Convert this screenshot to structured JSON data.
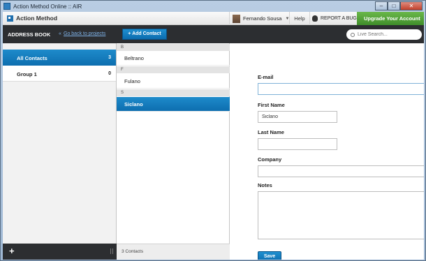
{
  "window": {
    "title": "Action Method Online :: AIR",
    "min": "–",
    "max": "□",
    "close": "✕"
  },
  "topbar": {
    "brand": "Action Method",
    "user": "Fernando Sousa",
    "user_caret": "▼",
    "help": "Help",
    "report_bug": "REPORT A BUG",
    "upgrade": "Upgrade Your Account",
    "upgrade_arrow": "›"
  },
  "toolbar": {
    "title": "ADDRESS BOOK",
    "go_back": "Go back to projects",
    "go_back_arrow": "«",
    "add_contact": "+ Add Contact",
    "search_placeholder": "Live Search..."
  },
  "sidebar": {
    "items": [
      {
        "label": "All Contacts",
        "count": "3",
        "active": true
      },
      {
        "label": "Group 1",
        "count": "0",
        "active": false
      }
    ],
    "add": "+"
  },
  "contacts": {
    "groups": [
      {
        "letter": "B",
        "names": [
          "Beltrano"
        ]
      },
      {
        "letter": "F",
        "names": [
          "Fulano"
        ]
      },
      {
        "letter": "S",
        "names": [
          "Siclano"
        ]
      }
    ],
    "selected": "Siclano",
    "footer": "3 Contacts"
  },
  "form": {
    "email_label": "E-mail",
    "email_value": "",
    "first_name_label": "First Name",
    "first_name_value": "Siclano",
    "last_name_label": "Last Name",
    "last_name_value": "",
    "company_label": "Company",
    "company_value": "",
    "notes_label": "Notes",
    "notes_value": "",
    "save": "Save"
  },
  "colors": {
    "accent_blue": "#0d6eaf",
    "upgrade_green": "#3f8d2a",
    "dark_bar": "#2c2e31"
  }
}
